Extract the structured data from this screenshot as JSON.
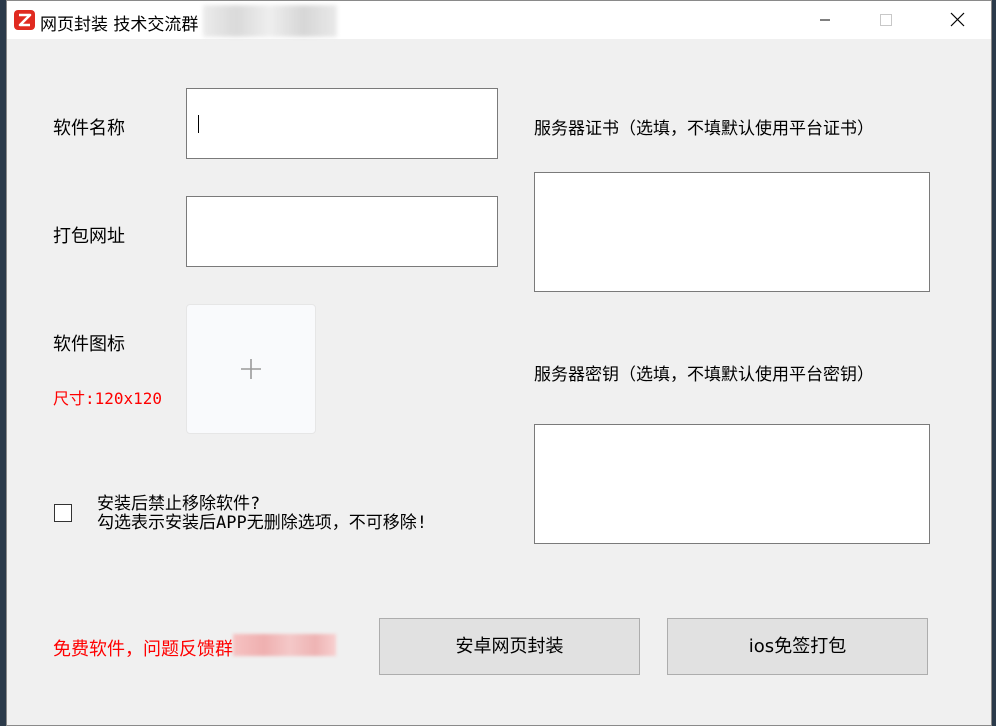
{
  "window": {
    "title": "网页封装 技术交流群",
    "controls": {
      "minimize_icon": "minimize-icon",
      "maximize_icon": "maximize-icon",
      "close_icon": "close-icon"
    },
    "logo_icon": "app-logo-icon"
  },
  "form": {
    "software_name_label": "软件名称",
    "software_name_value": "",
    "package_url_label": "打包网址",
    "package_url_value": "",
    "software_icon_label": "软件图标",
    "icon_size_hint": "尺寸:120x120",
    "icon_upload_icon": "plus-icon",
    "server_cert_label": "服务器证书（选填，不填默认使用平台证书）",
    "server_cert_value": "",
    "server_key_label": "服务器密钥（选填，不填默认使用平台密钥）",
    "server_key_value": "",
    "prevent_uninstall_checked": false,
    "prevent_uninstall_line1": "安装后禁止移除软件?",
    "prevent_uninstall_line2": "勾选表示安装后APP无删除选项，不可移除!"
  },
  "footer": {
    "notice": "免费软件，问题反馈群",
    "android_button": "安卓网页封装",
    "ios_button": "ios免签打包"
  },
  "colors": {
    "window_bg": "#f0f0f0",
    "accent_red": "#ff0000",
    "logo_red": "#e02a20",
    "button_bg": "#e1e1e1"
  }
}
